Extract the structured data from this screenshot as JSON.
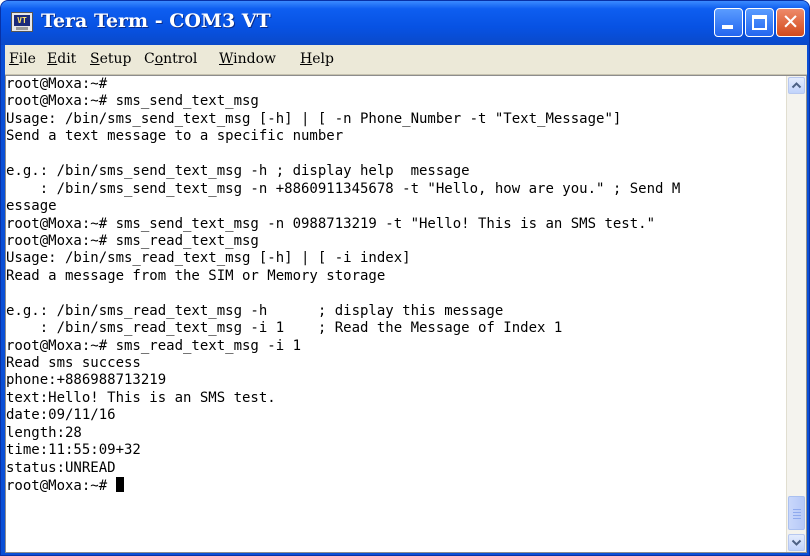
{
  "window": {
    "title": "Tera Term - COM3 VT",
    "icon_name": "teraterm-app-icon",
    "icon_text": "VT",
    "close_glyph": "✕"
  },
  "menu": [
    {
      "accel": "F",
      "rest": "ile"
    },
    {
      "accel": "E",
      "rest": "dit"
    },
    {
      "accel": "S",
      "rest": "etup"
    },
    {
      "pre": "C",
      "accel": "o",
      "rest": "ntrol"
    },
    {
      "accel": "W",
      "rest": "indow"
    },
    {
      "accel": "H",
      "rest": "elp"
    }
  ],
  "terminal": {
    "lines": [
      "root@Moxa:~#",
      "root@Moxa:~# sms_send_text_msg",
      "Usage: /bin/sms_send_text_msg [-h] | [ -n Phone_Number -t \"Text_Message\"]",
      "Send a text message to a specific number",
      "",
      "e.g.: /bin/sms_send_text_msg -h ; display help  message",
      "    : /bin/sms_send_text_msg -n +8860911345678 -t \"Hello, how are you.\" ; Send M",
      "essage",
      "root@Moxa:~# sms_send_text_msg -n 0988713219 -t \"Hello! This is an SMS test.\"",
      "root@Moxa:~# sms_read_text_msg",
      "Usage: /bin/sms_read_text_msg [-h] | [ -i index]",
      "Read a message from the SIM or Memory storage",
      "",
      "e.g.: /bin/sms_read_text_msg -h      ; display this message",
      "    : /bin/sms_read_text_msg -i 1    ; Read the Message of Index 1",
      "root@Moxa:~# sms_read_text_msg -i 1",
      "Read sms success",
      "phone:+886988713219",
      "text:Hello! This is an SMS test.",
      "date:09/11/16",
      "length:28",
      "time:11:55:09+32",
      "status:UNREAD"
    ],
    "prompt": "root@Moxa:~# "
  },
  "scrollbar": {
    "up_glyph": "▲",
    "down_glyph": "▼"
  }
}
